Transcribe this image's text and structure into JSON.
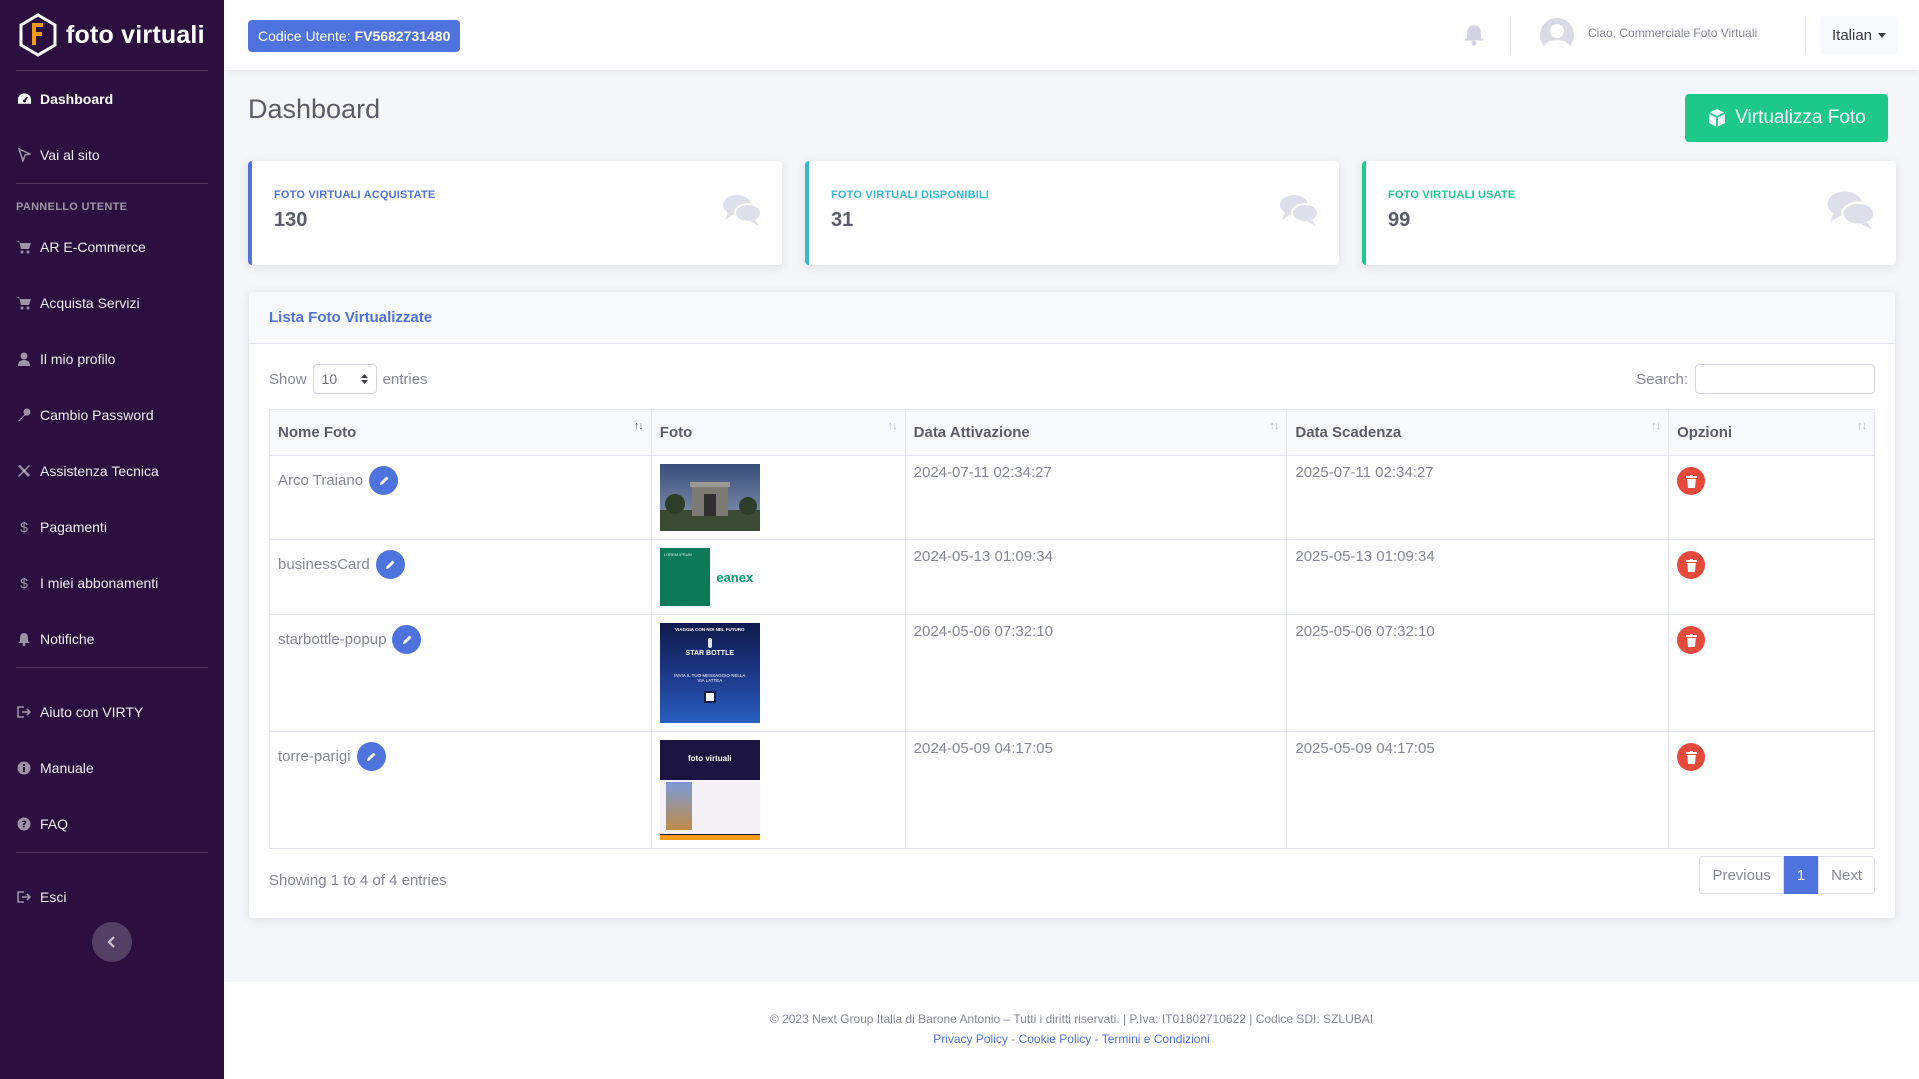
{
  "brand": {
    "name": "foto virtuali"
  },
  "sidebar": {
    "items_top": [
      {
        "label": "Dashboard",
        "icon": "dashboard-icon"
      },
      {
        "label": "Vai al sito",
        "icon": "cursor-icon"
      }
    ],
    "section_heading": "PANNELLO UTENTE",
    "items_panel": [
      {
        "label": "AR E-Commerce",
        "icon": "cart-icon"
      },
      {
        "label": "Acquista Servizi",
        "icon": "cart-icon"
      },
      {
        "label": "Il mio profilo",
        "icon": "user-icon"
      },
      {
        "label": "Cambio Password",
        "icon": "key-icon"
      },
      {
        "label": "Assistenza Tecnica",
        "icon": "tools-icon"
      },
      {
        "label": "Pagamenti",
        "icon": "dollar-icon"
      },
      {
        "label": "I miei abbonamenti",
        "icon": "dollar-icon"
      },
      {
        "label": "Notifiche",
        "icon": "bell-icon"
      }
    ],
    "items_help": [
      {
        "label": "Aiuto con VIRTY",
        "icon": "sign-out-icon"
      },
      {
        "label": "Manuale",
        "icon": "info-icon"
      },
      {
        "label": "FAQ",
        "icon": "question-icon"
      }
    ],
    "items_bottom": [
      {
        "label": "Esci",
        "icon": "sign-out-icon"
      }
    ]
  },
  "topbar": {
    "user_code_label": "Codice Utente:",
    "user_code_value": "FV5682731480",
    "greeting": "Ciao, Commerciale Foto Virtuali",
    "language": "Italian"
  },
  "page": {
    "title": "Dashboard",
    "cta_label": "Virtualizza Foto"
  },
  "stats": [
    {
      "label": "FOTO VIRTUALI ACQUISTATE",
      "value": "130",
      "color": "#4e73df"
    },
    {
      "label": "FOTO VIRTUALI DISPONIBILI",
      "value": "31",
      "color": "#36b9cc"
    },
    {
      "label": "FOTO VIRTUALI USATE",
      "value": "99",
      "color": "#1cc88a"
    }
  ],
  "table_card": {
    "title": "Lista Foto Virtualizzate",
    "show_label": "Show",
    "entries_value": "10",
    "entries_label": "entries",
    "search_label": "Search:",
    "columns": [
      "Nome Foto",
      "Foto",
      "Data Attivazione",
      "Data Scadenza",
      "Opzioni"
    ],
    "rows": [
      {
        "name": "Arco Traiano",
        "activation": "2024-07-11 02:34:27",
        "expiry": "2025-07-11 02:34:27"
      },
      {
        "name": "businessCard",
        "activation": "2024-05-13 01:09:34",
        "expiry": "2025-05-13 01:09:34"
      },
      {
        "name": "starbottle-popup",
        "activation": "2024-05-06 07:32:10",
        "expiry": "2025-05-06 07:32:10"
      },
      {
        "name": "torre-parigi",
        "activation": "2024-05-09 04:17:05",
        "expiry": "2025-05-09 04:17:05"
      }
    ],
    "info": "Showing 1 to 4 of 4 entries",
    "pagination": {
      "previous": "Previous",
      "current": "1",
      "next": "Next"
    }
  },
  "footer": {
    "copyright": "© 2023 Next Group Italia di Barone Antonio – Tutti i diritti riservati. | P.Iva: IT01802710622 | Codice SDI: SZLUBAI",
    "links": [
      "Privacy Policy",
      "Cookie Policy",
      "Termini e Condizioni"
    ]
  },
  "thumbnails": {
    "business_card_brand": "eanex",
    "business_card_caption": "LOREM IPSUM",
    "starbottle_top": "VIAGGIA CON NOI NEL FUTURO",
    "starbottle_title": "STAR BOTTLE",
    "starbottle_sub": "INVIA IL TUO MESSAGGIO NELLA VIA LATTEA",
    "torre_brand": "foto virtuali"
  }
}
